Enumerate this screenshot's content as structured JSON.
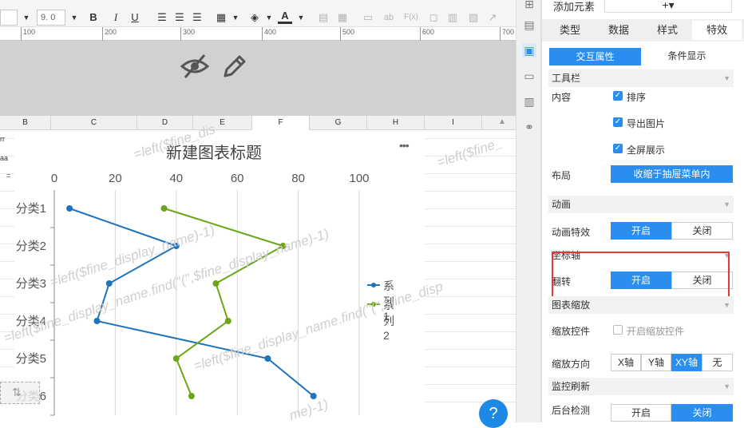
{
  "toolbar": {
    "font_size": "9. 0",
    "buttons": [
      "bold-icon",
      "italic-icon",
      "underline-icon",
      "align-left-icon",
      "align-center-icon",
      "align-right-icon",
      "border-icon",
      "fill-color-icon",
      "font-color-icon",
      "merge-icon",
      "table-icon",
      "text-icon",
      "abc-icon",
      "formula-icon",
      "chart-icon",
      "image-icon",
      "brush-icon"
    ],
    "bold": "B",
    "italic": "I",
    "underline": "U",
    "font_color": "A",
    "abc": "ab",
    "formula": "F(x)"
  },
  "ruler": [
    "100",
    "200",
    "300",
    "400",
    "500",
    "600",
    "700"
  ],
  "columns": [
    "B",
    "C",
    "D",
    "E",
    "F",
    "G",
    "H",
    "I"
  ],
  "row_cells": [
    "rr",
    "aa",
    "="
  ],
  "chart_data": {
    "type": "line",
    "title": "新建图表标题",
    "categories": [
      "分类1",
      "分类2",
      "分类3",
      "分类4",
      "分类5",
      "分类6"
    ],
    "series": [
      {
        "name": "系列1",
        "color": "#1e73be",
        "values": [
          5,
          40,
          18,
          14,
          70,
          85
        ]
      },
      {
        "name": "系列2",
        "color": "#6aa617",
        "values": [
          36,
          75,
          53,
          57,
          40,
          45
        ]
      }
    ],
    "x_ticks": [
      "0",
      "20",
      "40",
      "60",
      "80",
      "100"
    ],
    "xlim": [
      0,
      100
    ],
    "orientation": "horizontal-values",
    "legend": "right",
    "grid": true,
    "menu": "•••"
  },
  "watermarks": [
    "=left($fine_dis",
    "=left($fine_display_name)-1)",
    "=left($fine_display_name.find(\"(\",$fine_display_name)-1)",
    "=left($fine_display_name.find(\"(\",$fine_disp",
    "me)-1)",
    "=left($fine_"
  ],
  "help": "?",
  "panel": {
    "add_element": "添加元素",
    "add_icon": "+▾",
    "tabs": [
      "类型",
      "数据",
      "样式",
      "特效"
    ],
    "subtabs": [
      "交互属性",
      "条件显示"
    ],
    "toolbar_section": "工具栏",
    "content_label": "内容",
    "content_items": [
      "排序",
      "导出图片",
      "全屏展示"
    ],
    "layout_label": "布局",
    "layout_value": "收缩于抽屉菜单内",
    "animation_section": "动画",
    "animation_effect_label": "动画特效",
    "on": "开启",
    "off": "关闭",
    "axis_section": "坐标轴",
    "flip_label": "翻转",
    "zoom_section": "图表缩放",
    "zoom_ctrl_label": "缩放控件",
    "zoom_ctrl_check": "开启缩放控件",
    "zoom_dir_label": "缩放方向",
    "zoom_dirs": [
      "X轴",
      "Y轴",
      "XY轴",
      "无"
    ],
    "refresh_section": "监控刷新",
    "backend_label": "后台检测"
  },
  "colors": {
    "accent": "#2a8ef0",
    "highlight": "#e53935"
  }
}
